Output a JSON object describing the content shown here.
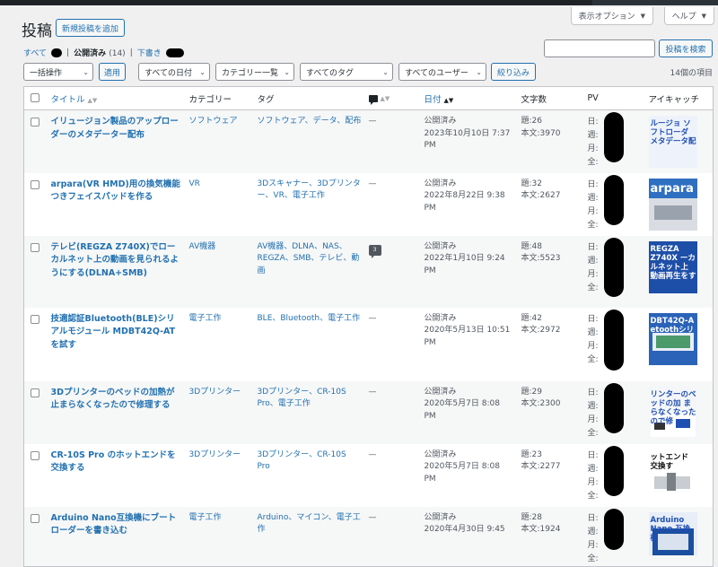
{
  "header": {
    "screen_options_label": "表示オプション",
    "help_label": "ヘルプ",
    "title": "投稿",
    "add_new_label": "新規投稿を追加"
  },
  "views": {
    "all_label": "すべて",
    "published_label": "公開済み",
    "published_count": "(14)",
    "separator": "|",
    "drafts_label": "下書き"
  },
  "search": {
    "value": "",
    "button_label": "投稿を検索"
  },
  "filters": {
    "bulk_action": "一括操作",
    "apply_label": "適用",
    "dates": "すべての日付",
    "categories": "カテゴリー一覧",
    "tags": "すべてのタグ",
    "users": "すべてのユーザー",
    "filter_label": "絞り込み",
    "items_count": "14個の項目"
  },
  "columns": {
    "title": "タイトル",
    "category": "カテゴリー",
    "tags": "タグ",
    "date": "日付",
    "word_count": "文字数",
    "pv": "PV",
    "eyecatch": "アイキャッチ"
  },
  "pv_labels": [
    "日:",
    "週:",
    "月:",
    "全:"
  ],
  "rows": [
    {
      "title": "イリュージョン製品のアップローダーのメタデーター配布",
      "category": "ソフトウェア",
      "tags": "ソフトウェア、データ、配布",
      "comments": "—",
      "status": "公開済み",
      "date": "2023年10月10日 7:37 PM",
      "wc_title": "題:26",
      "wc_body": "本文:3970",
      "thumb": {
        "bg": "#eef3fb",
        "text": "ルージョ ソフトローダ メタデータ配",
        "text_color": "#1f4fb3",
        "style": "text"
      }
    },
    {
      "title": "arpara(VR HMD)用の換気機能つきフェイスパッドを作る",
      "category": "VR",
      "tags": "3Dスキャナー、3Dプリンター、VR、電子工作",
      "comments": "—",
      "status": "公開済み",
      "date": "2022年8月22日 9:38 PM",
      "wc_title": "題:32",
      "wc_body": "本文:2627",
      "thumb": {
        "bg": "#2f6fc2",
        "text": "arpara",
        "text_color": "#ffffff",
        "style": "banner"
      }
    },
    {
      "title": "テレビ(REGZA Z740X)でローカルネット上の動画を見られるようにする(DLNA+SMB)",
      "category": "AV機器",
      "tags": "AV機器、DLNA、NAS、REGZA、SMB、テレビ、動画",
      "comments": "3",
      "status": "公開済み",
      "date": "2022年1月10日 9:24 PM",
      "wc_title": "題:48",
      "wc_body": "本文:5523",
      "thumb": {
        "bg": "#1e4fa8",
        "text": "REGZA Z740X ーカルネット上 動画再生をす",
        "text_color": "#ffffff",
        "style": "text"
      }
    },
    {
      "title": "技適認証Bluetooth(BLE)シリアルモジュール MDBT42Q-AT を試す",
      "category": "電子工作",
      "tags": "BLE、Bluetooth、電子工作",
      "comments": "—",
      "status": "公開済み",
      "date": "2020年5月13日 10:51 PM",
      "wc_title": "題:42",
      "wc_body": "本文:2972",
      "thumb": {
        "bg": "#2a63b8",
        "text": "DBT42Q-A etoothシリ",
        "text_color": "#ffffff",
        "style": "board"
      }
    },
    {
      "title": "3Dプリンターのベッドの加熱が止まらなくなったので修理する",
      "category": "3Dプリンター",
      "tags": "3Dプリンター、CR-10S Pro、電子工作",
      "comments": "—",
      "status": "公開済み",
      "date": "2020年5月7日 8:08 PM",
      "wc_title": "題:29",
      "wc_body": "本文:2300",
      "thumb": {
        "bg": "#f4f6f9",
        "text": "リンターのベッドの加 まらなくなったので修",
        "text_color": "#1f4fb3",
        "style": "parts"
      }
    },
    {
      "title": "CR-10S Pro のホットエンドを交換する",
      "category": "3Dプリンター",
      "tags": "3Dプリンター、CR-10S Pro",
      "comments": "—",
      "status": "公開済み",
      "date": "2020年5月7日 8:08 PM",
      "wc_title": "題:23",
      "wc_body": "本文:2277",
      "thumb": {
        "bg": "#ffffff",
        "text": "ットエンド 交換す",
        "text_color": "#111111",
        "style": "hotend"
      }
    },
    {
      "title": "Arduino Nano互換機にブートローダーを書き込む",
      "category": "電子工作",
      "tags": "Arduino、マイコン、電子工作",
      "comments": "—",
      "status": "公開済み",
      "date": "2020年4月30日 9:45",
      "wc_title": "題:28",
      "wc_body": "本文:1924",
      "thumb": {
        "bg": "#e7eef8",
        "text": "Arduino Nano 互換機",
        "text_color": "#1f4fb3",
        "style": "board2"
      }
    }
  ],
  "colors": {
    "link": "#2271b1",
    "text": "#1d2327",
    "muted": "#50575e",
    "border": "#c3c4c7",
    "background": "#f0f0f1",
    "row_alt": "#f6f7f7"
  }
}
